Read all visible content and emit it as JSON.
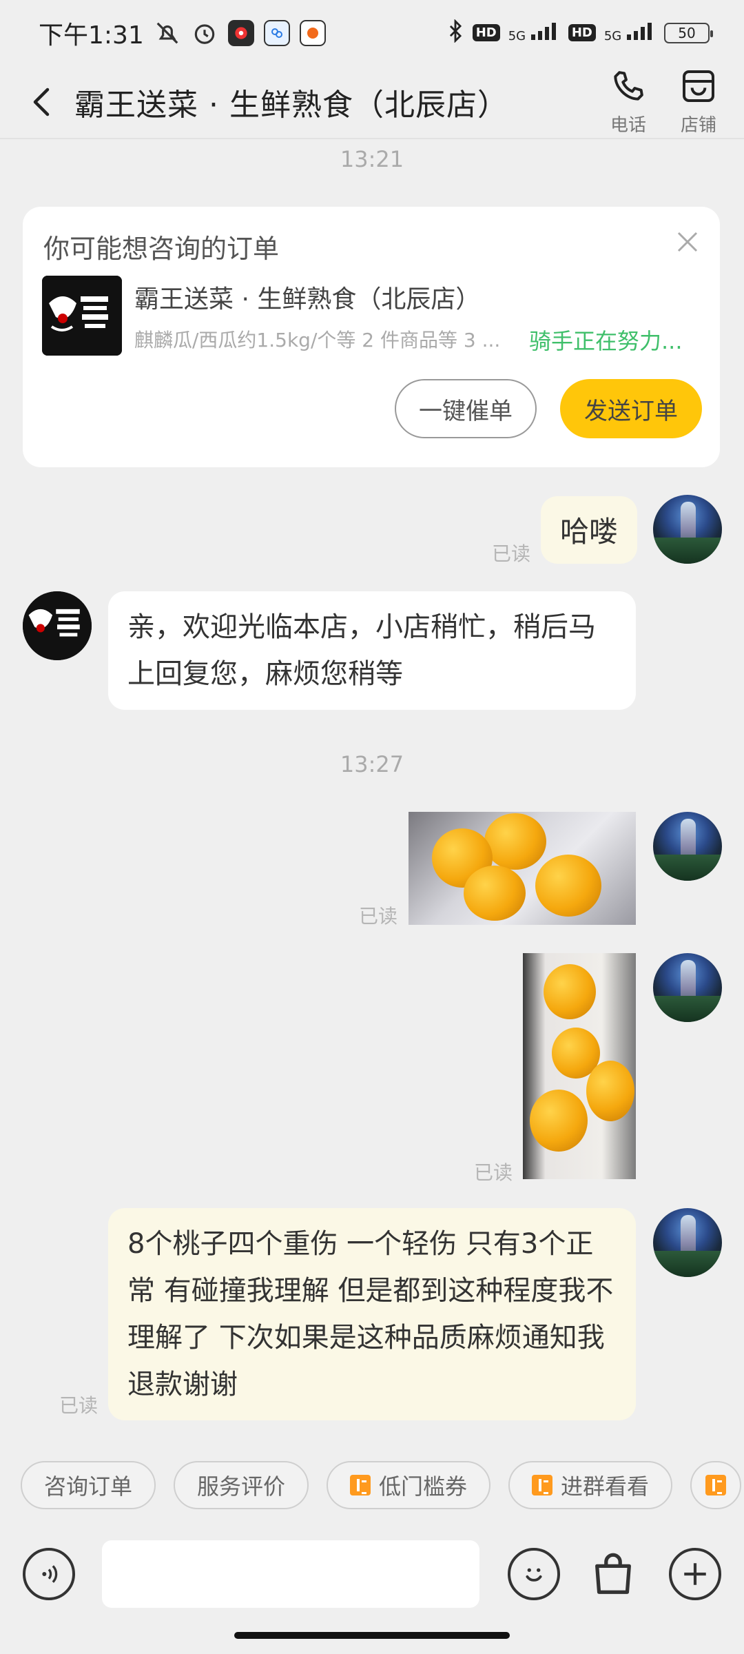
{
  "status_bar": {
    "time": "下午1:31",
    "signal_1": "5G",
    "signal_2": "5G",
    "hd_1": "HD",
    "hd_2": "HD",
    "battery": "50"
  },
  "header": {
    "title": "霸王送菜 · 生鲜熟食（北辰店）",
    "phone_label": "电话",
    "store_label": "店铺"
  },
  "order_card": {
    "heading": "你可能想咨询的订单",
    "shop_name": "霸王送菜 · 生鲜熟食（北辰店）",
    "items": "麒麟瓜/西瓜约1.5kg/个等 2 件商品等 3 ...",
    "status": "骑手正在努力...",
    "urge_button": "一键催单",
    "send_button": "发送订单"
  },
  "messages": {
    "time_1": "13:21",
    "msg_hello": "哈喽",
    "read_1": "已读",
    "msg_shop_reply": "亲，欢迎光临本店，小店稍忙，稍后马上回复您，麻烦您稍等",
    "time_2": "13:27",
    "read_2": "已读",
    "read_3": "已读",
    "msg_complaint": "8个桃子四个重伤 一个轻伤  只有3个正常   有碰撞我理解 但是都到这种程度我不理解了 下次如果是这种品质麻烦通知我退款谢谢",
    "read_4": "已读"
  },
  "quick_actions": {
    "chip_1": "咨询订单",
    "chip_2": "服务评价",
    "chip_3": "低门槛券",
    "chip_4": "进群看看"
  },
  "colors": {
    "accent_yellow": "#ffc60a",
    "status_green": "#3fbf6a",
    "my_bubble": "#fbf8e6"
  }
}
